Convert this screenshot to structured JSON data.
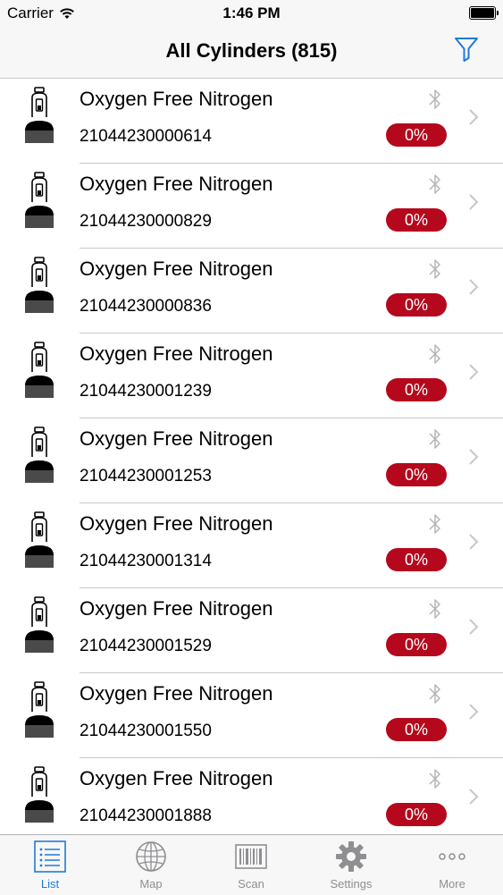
{
  "status_bar": {
    "carrier": "Carrier",
    "time": "1:46 PM"
  },
  "nav": {
    "title": "All Cylinders (815)"
  },
  "colors": {
    "accent": "#1e7bd8",
    "badge": "#b5081c"
  },
  "rows": [
    {
      "gas": "Oxygen Free Nitrogen",
      "serial": "21044230000614",
      "level": "0%"
    },
    {
      "gas": "Oxygen Free Nitrogen",
      "serial": "21044230000829",
      "level": "0%"
    },
    {
      "gas": "Oxygen Free Nitrogen",
      "serial": "21044230000836",
      "level": "0%"
    },
    {
      "gas": "Oxygen Free Nitrogen",
      "serial": "21044230001239",
      "level": "0%"
    },
    {
      "gas": "Oxygen Free Nitrogen",
      "serial": "21044230001253",
      "level": "0%"
    },
    {
      "gas": "Oxygen Free Nitrogen",
      "serial": "21044230001314",
      "level": "0%"
    },
    {
      "gas": "Oxygen Free Nitrogen",
      "serial": "21044230001529",
      "level": "0%"
    },
    {
      "gas": "Oxygen Free Nitrogen",
      "serial": "21044230001550",
      "level": "0%"
    },
    {
      "gas": "Oxygen Free Nitrogen",
      "serial": "21044230001888",
      "level": "0%"
    }
  ],
  "tabs": [
    {
      "label": "List",
      "icon": "list-icon",
      "active": true
    },
    {
      "label": "Map",
      "icon": "globe-icon",
      "active": false
    },
    {
      "label": "Scan",
      "icon": "barcode-icon",
      "active": false
    },
    {
      "label": "Settings",
      "icon": "gear-icon",
      "active": false
    },
    {
      "label": "More",
      "icon": "more-icon",
      "active": false
    }
  ]
}
